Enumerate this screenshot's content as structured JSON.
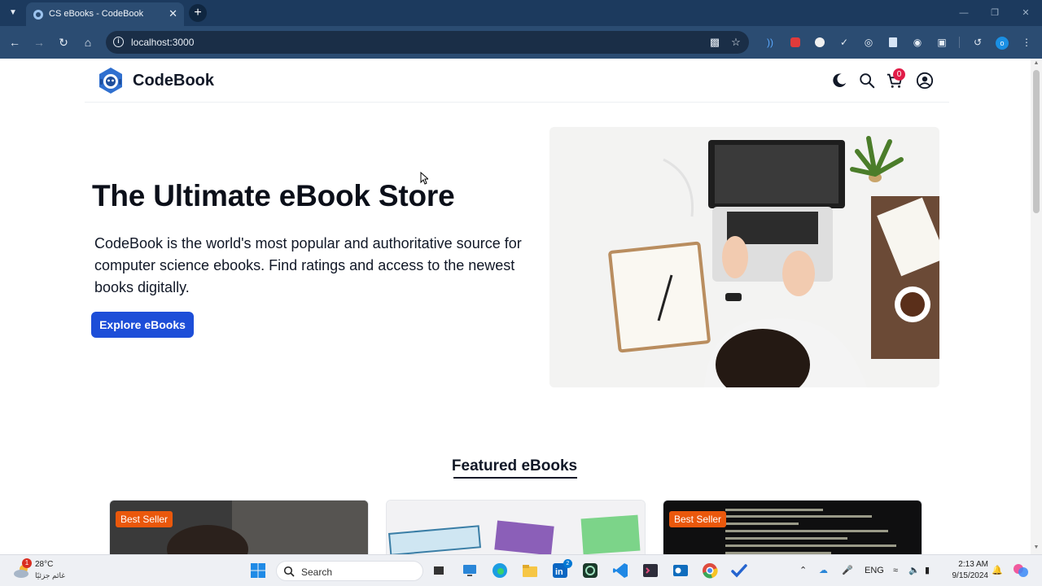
{
  "browser": {
    "tab_title": "CS eBooks - CodeBook",
    "url": "localhost:3000"
  },
  "header": {
    "brand": "CodeBook",
    "cart_count": "0"
  },
  "hero": {
    "title": "The Ultimate eBook Store",
    "description": "CodeBook is the world's most popular and authoritative source for computer science ebooks. Find ratings and access to the newest books digitally.",
    "cta_label": "Explore eBooks"
  },
  "featured": {
    "title": "Featured eBooks",
    "cards": [
      {
        "badge": "Best Seller"
      },
      {
        "badge": ""
      },
      {
        "badge": "Best Seller"
      }
    ]
  },
  "taskbar": {
    "weather_temp": "28°C",
    "weather_desc": "غائم جزئيًا",
    "weather_alerts": "1",
    "search_label": "Search",
    "language": "ENG",
    "time": "2:13 AM",
    "date": "9/15/2024",
    "linkedin_badge": "2"
  },
  "colors": {
    "primary_button": "#1d4ed8",
    "badge": "#ea580c",
    "cart_badge": "#e11d48",
    "browser_frame": "#1c3a5e"
  }
}
